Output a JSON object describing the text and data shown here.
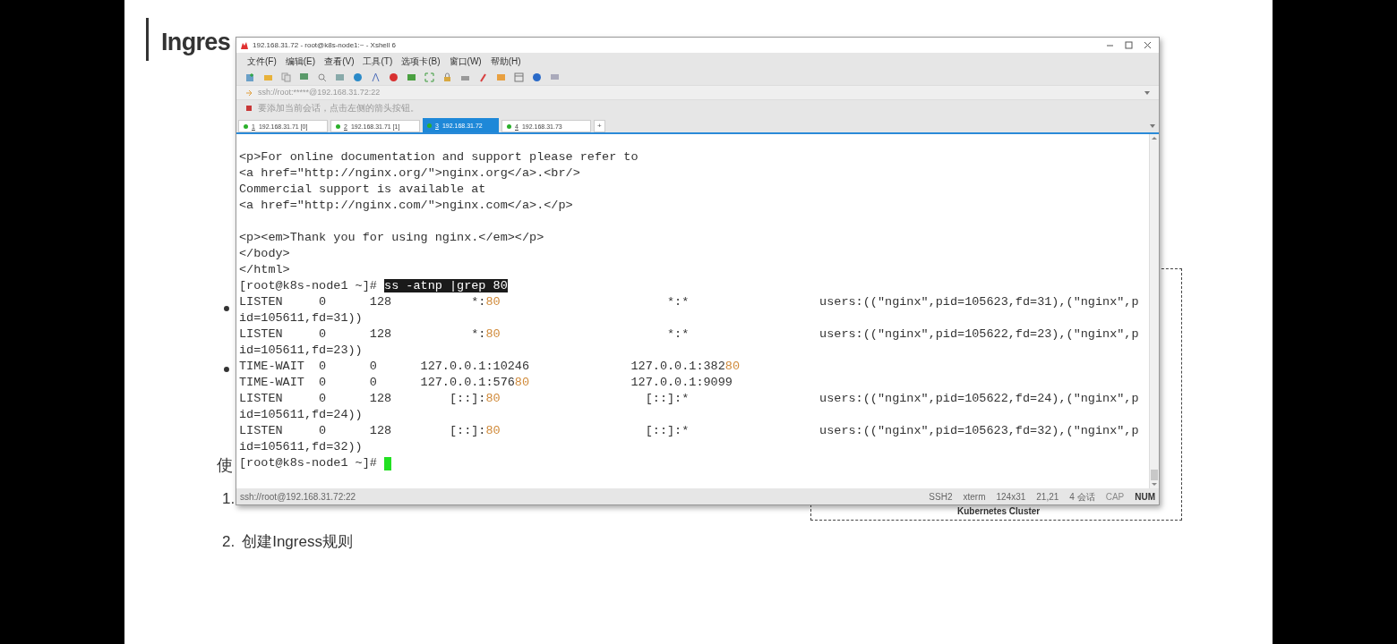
{
  "slide": {
    "title": "Ingres",
    "side_text": "使",
    "numbered": [
      {
        "number": "1."
      },
      {
        "number": "2.",
        "text": "创建Ingress规则"
      }
    ],
    "diagram_label": "Kubernetes Cluster"
  },
  "window": {
    "title": "192.168.31.72 - root@k8s-node1:~ - Xshell 6",
    "menu": [
      "文件(F)",
      "编辑(E)",
      "查看(V)",
      "工具(T)",
      "选项卡(B)",
      "窗口(W)",
      "帮助(H)"
    ],
    "address": "ssh://root:*****@192.168.31.72:22",
    "hint": "要添加当前会话，点击左侧的箭头按钮。",
    "tabs": [
      {
        "number": "1",
        "label": "192.168.31.71 [0]",
        "selected": false
      },
      {
        "number": "2",
        "label": "192.168.31.71 [1]",
        "selected": false
      },
      {
        "number": "3",
        "label": "192.168.31.72",
        "selected": true
      },
      {
        "number": "4",
        "label": "192.168.31.73",
        "selected": false
      }
    ],
    "new_tab": "+",
    "terminal": {
      "lines": [
        {
          "cursor": false,
          "segments": [
            {
              "kind": "plain",
              "text": "<p>For online documentation and support please refer to"
            }
          ]
        },
        {
          "cursor": false,
          "segments": [
            {
              "kind": "plain",
              "text": "<a href=\"http://nginx.org/\">nginx.org</a>.<br/>"
            }
          ]
        },
        {
          "cursor": false,
          "segments": [
            {
              "kind": "plain",
              "text": "Commercial support is available at"
            }
          ]
        },
        {
          "cursor": false,
          "segments": [
            {
              "kind": "plain",
              "text": "<a href=\"http://nginx.com/\">nginx.com</a>.</p>"
            }
          ]
        },
        {
          "cursor": false
        },
        {
          "cursor": false,
          "segments": [
            {
              "kind": "plain",
              "text": "<p><em>Thank you for using nginx.</em></p>"
            }
          ]
        },
        {
          "cursor": false,
          "segments": [
            {
              "kind": "plain",
              "text": "</body>"
            }
          ]
        },
        {
          "cursor": false,
          "segments": [
            {
              "kind": "plain",
              "text": "</html>"
            }
          ]
        },
        {
          "cursor": false,
          "segments": [
            {
              "kind": "plain",
              "text": "[root@k8s-node1 ~]# "
            },
            {
              "kind": "selected",
              "text": "ss -atnp |grep 80"
            }
          ]
        },
        {
          "cursor": false,
          "segments": [
            {
              "kind": "plain",
              "text": "LISTEN     0      128           *:"
            },
            {
              "kind": "port",
              "text": "80"
            },
            {
              "kind": "plain",
              "text": "                       *:*                  users:((\"nginx\",pid=105623,fd=31),(\"nginx\",p"
            }
          ]
        },
        {
          "cursor": false,
          "segments": [
            {
              "kind": "plain",
              "text": "id=105611,fd=31))"
            }
          ]
        },
        {
          "cursor": false,
          "segments": [
            {
              "kind": "plain",
              "text": "LISTEN     0      128           *:"
            },
            {
              "kind": "port",
              "text": "80"
            },
            {
              "kind": "plain",
              "text": "                       *:*                  users:((\"nginx\",pid=105622,fd=23),(\"nginx\",p"
            }
          ]
        },
        {
          "cursor": false,
          "segments": [
            {
              "kind": "plain",
              "text": "id=105611,fd=23))"
            }
          ]
        },
        {
          "cursor": false,
          "segments": [
            {
              "kind": "plain",
              "text": "TIME-WAIT  0      0      127.0.0.1:10246              127.0.0.1:382"
            },
            {
              "kind": "port",
              "text": "80"
            }
          ]
        },
        {
          "cursor": false,
          "segments": [
            {
              "kind": "plain",
              "text": "TIME-WAIT  0      0      127.0.0.1:576"
            },
            {
              "kind": "port",
              "text": "80"
            },
            {
              "kind": "plain",
              "text": "              127.0.0.1:9099"
            }
          ]
        },
        {
          "cursor": false,
          "segments": [
            {
              "kind": "plain",
              "text": "LISTEN     0      128        [::]:"
            },
            {
              "kind": "port",
              "text": "80"
            },
            {
              "kind": "plain",
              "text": "                    [::]:*                  users:((\"nginx\",pid=105622,fd=24),(\"nginx\",p"
            }
          ]
        },
        {
          "cursor": false,
          "segments": [
            {
              "kind": "plain",
              "text": "id=105611,fd=24))"
            }
          ]
        },
        {
          "cursor": false,
          "segments": [
            {
              "kind": "plain",
              "text": "LISTEN     0      128        [::]:"
            },
            {
              "kind": "port",
              "text": "80"
            },
            {
              "kind": "plain",
              "text": "                    [::]:*                  users:((\"nginx\",pid=105623,fd=32),(\"nginx\",p"
            }
          ]
        },
        {
          "cursor": false,
          "segments": [
            {
              "kind": "plain",
              "text": "id=105611,fd=32))"
            }
          ]
        },
        {
          "cursor": true,
          "segments": [
            {
              "kind": "plain",
              "text": "[root@k8s-node1 ~]# "
            }
          ]
        }
      ]
    },
    "status_bar": {
      "connection": "ssh://root@192.168.31.72:22",
      "fields": [
        "SSH2",
        "xterm",
        "124x31",
        "21,21",
        "4 会话"
      ],
      "indicators": [
        {
          "text": "CAP",
          "on": false
        },
        {
          "text": "NUM",
          "on": true
        }
      ]
    }
  }
}
